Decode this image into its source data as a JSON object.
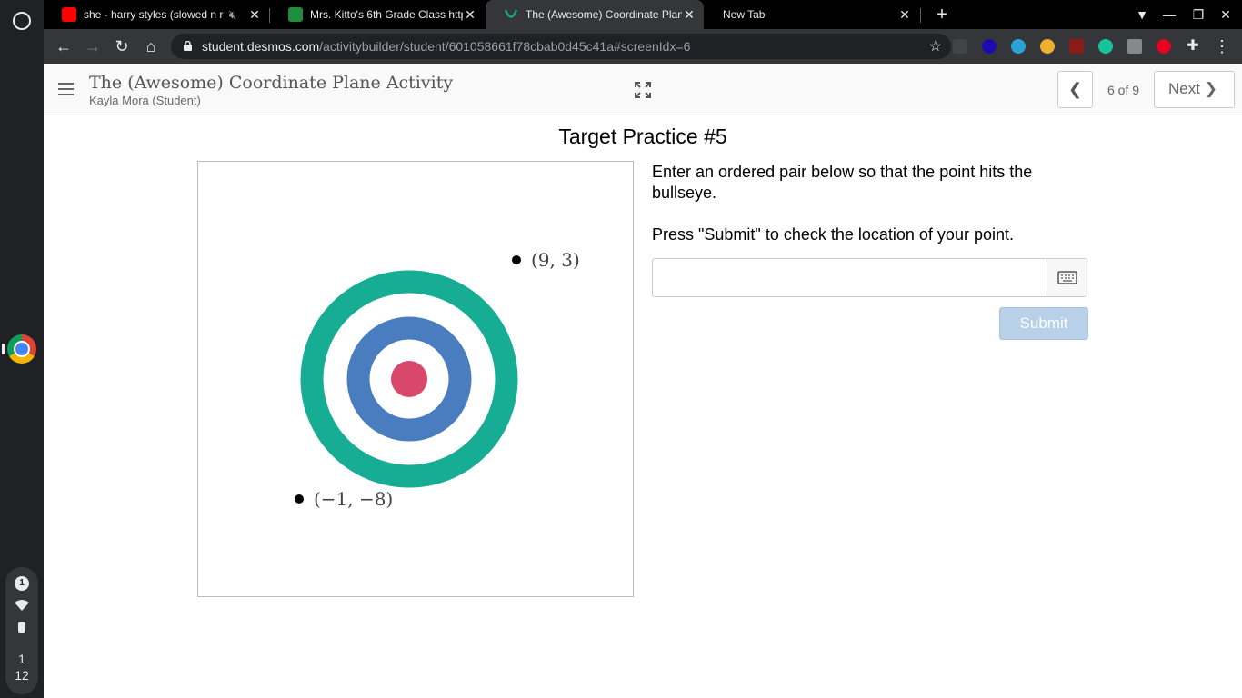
{
  "browser": {
    "tabs": [
      {
        "label": "she - harry styles (slowed n r",
        "icon": "youtube-icon",
        "color": "#ff0000"
      },
      {
        "label": "Mrs. Kitto's 6th Grade Class http",
        "icon": "google-classroom-icon",
        "color": "#1e8e3e"
      },
      {
        "label": "The (Awesome) Coordinate Plan",
        "icon": "desmos-icon",
        "color": "#1aa27e"
      },
      {
        "label": "New Tab",
        "icon": "new-tab-page-icon"
      }
    ],
    "url_host": "student.desmos.com",
    "url_path": "/activitybuilder/student/601058661f78cbab0d45c41a#screenIdx=6"
  },
  "system": {
    "notification_count": "1",
    "clock_hour": "1",
    "clock_minute": "12"
  },
  "header": {
    "activity_title": "The (Awesome) Coordinate Plane Activity",
    "student": "Kayla Mora (Student)",
    "page_indicator": "6 of 9",
    "next_label": "Next"
  },
  "screen": {
    "title": "Target Practice #5",
    "instruction_1": "Enter an ordered pair below so that the point hits the bullseye.",
    "instruction_2": "Press \"Submit\" to check the location of your point.",
    "answer_value": "",
    "submit_label": "Submit"
  },
  "graph": {
    "points": [
      {
        "label": "(9, 3)"
      },
      {
        "label": "(−1, −8)"
      }
    ],
    "colors": {
      "outer_ring": "#17ad94",
      "middle_ring": "#4a7dbf",
      "bullseye": "#d9486b"
    }
  }
}
